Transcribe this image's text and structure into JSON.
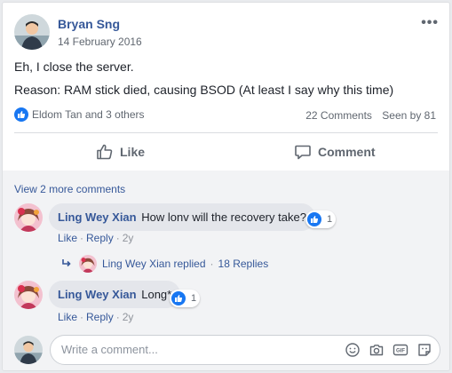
{
  "post": {
    "author": "Bryan Sng",
    "date": "14 February 2016",
    "text_line1": "Eh, I close the server.",
    "text_line2": "Reason: RAM stick died, causing BSOD (At least I say why this time)",
    "reactions_text": "Eldom Tan and 3 others",
    "comments_count": "22 Comments",
    "seen_by": "Seen by 81",
    "more_icon": "more-options-icon",
    "accent": "#365899",
    "like_blue": "#1877f2"
  },
  "actions": {
    "like_label": "Like",
    "comment_label": "Comment"
  },
  "comments_section": {
    "view_more": "View 2 more comments",
    "comment1": {
      "name": "Ling Wey Xian",
      "text": "How lonv will the recovery take?",
      "reaction_count": "1",
      "like_label": "Like",
      "reply_label": "Reply",
      "time": "2y"
    },
    "replies_summary": {
      "text": "Ling Wey Xian replied",
      "count": "18 Replies"
    },
    "comment2": {
      "name": "Ling Wey Xian",
      "text": "Long*",
      "reaction_count": "1",
      "like_label": "Like",
      "reply_label": "Reply",
      "time": "2y"
    },
    "composer": {
      "placeholder": "Write a comment...",
      "icons": [
        "emoji-icon",
        "camera-icon",
        "gif-icon",
        "sticker-icon"
      ]
    }
  }
}
